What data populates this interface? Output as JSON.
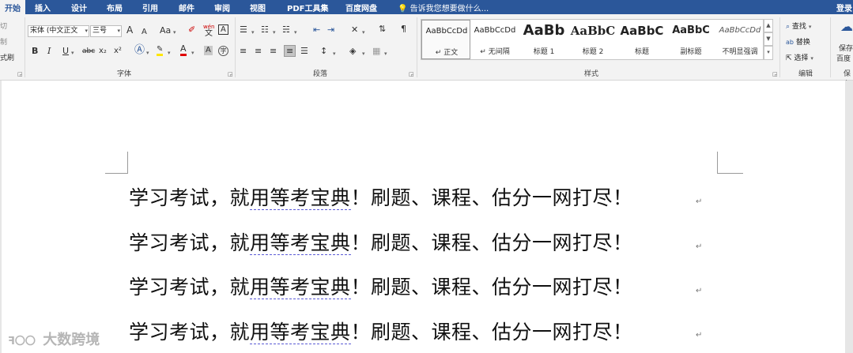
{
  "menubar": {
    "tabs": [
      "开始",
      "插入",
      "设计",
      "布局",
      "引用",
      "邮件",
      "审阅",
      "视图",
      "PDF工具集",
      "百度网盘"
    ],
    "tell_me": "告诉我您想要做什么...",
    "login": "登录",
    "accent": "#2b579a"
  },
  "clipboard": {
    "cut": "切",
    "copy": "制",
    "format_painter": "式刷"
  },
  "font": {
    "family": "宋体 (中文正文",
    "size": "三号",
    "case_label": "Aa",
    "group_label": "字体",
    "bold": "B",
    "italic": "I",
    "underline": "U",
    "strike": "abc",
    "subscript": "x₂",
    "superscript": "x²",
    "grow": "A",
    "shrink": "A",
    "phonetic": "wén",
    "phonetic_char": "文",
    "border_char": "A",
    "font_color_char": "A",
    "shade_char": "A",
    "circle_char": "字"
  },
  "paragraph": {
    "group_label": "段落"
  },
  "styles": {
    "group_label": "样式",
    "items": [
      {
        "sample": "AaBbCcDd",
        "label": "↵ 正文"
      },
      {
        "sample": "AaBbCcDd",
        "label": "↵ 无间隔"
      },
      {
        "sample": "AaBb",
        "label": "标题 1"
      },
      {
        "sample": "AaBbC",
        "label": "标题 2"
      },
      {
        "sample": "AaBbC",
        "label": "标题"
      },
      {
        "sample": "AaBbC",
        "label": "副标题"
      },
      {
        "sample": "AaBbCcDd",
        "label": "不明显强调"
      }
    ]
  },
  "editing": {
    "group_label": "编辑",
    "find": "查找",
    "replace": "替换",
    "select": "选择"
  },
  "save_group": {
    "save": "保存",
    "baidu": "百度",
    "group_label": "保存"
  },
  "document": {
    "lines": [
      {
        "a": "学习考试，就",
        "b": "用等考宝典",
        "c": "！刷题、课程、估分一网打尽！"
      },
      {
        "a": "学习考试，就",
        "b": "用等考宝典",
        "c": "！刷题、课程、估分一网打尽！"
      },
      {
        "a": "学习考试，就",
        "b": "用等考宝典",
        "c": "！刷题、课程、估分一网打尽！"
      },
      {
        "a": "学习考试，就",
        "b": "用等考宝典",
        "c": "！刷题、课程、估分一网打尽！"
      }
    ],
    "paragraph_mark": "↵"
  },
  "watermark": {
    "text": "大数跨境",
    "logo": "ꟻ〇〇"
  }
}
